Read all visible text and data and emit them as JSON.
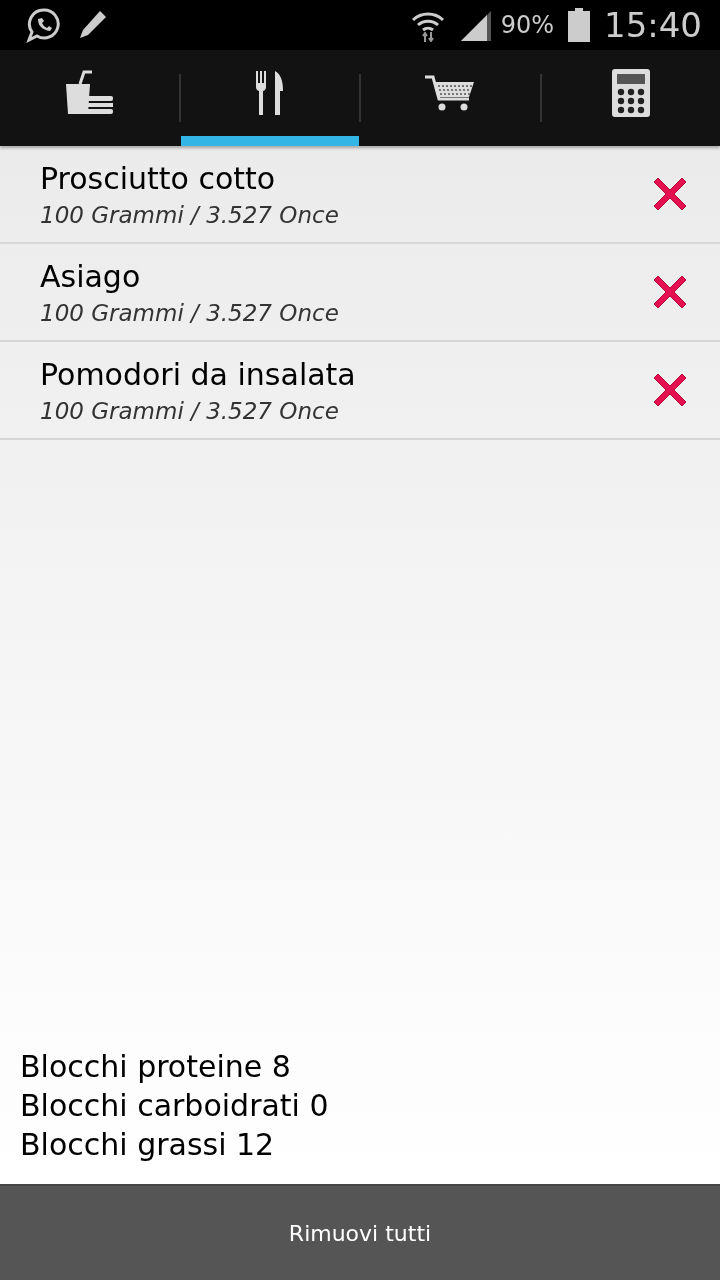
{
  "status_bar": {
    "battery": "90%",
    "time": "15:40"
  },
  "tabs": [
    {
      "kind": "meal",
      "selected": false
    },
    {
      "kind": "cutlery",
      "selected": true
    },
    {
      "kind": "cart",
      "selected": false
    },
    {
      "kind": "calculator",
      "selected": false
    }
  ],
  "items": [
    {
      "name": "Prosciutto cotto",
      "amount": "100 Grammi / 3.527 Once"
    },
    {
      "name": "Asiago",
      "amount": "100 Grammi / 3.527 Once"
    },
    {
      "name": "Pomodori da insalata",
      "amount": "100 Grammi / 3.527 Once"
    }
  ],
  "totals": [
    "Blocchi proteine 8",
    "Blocchi carboidrati 0",
    "Blocchi grassi 12"
  ],
  "button": "Rimuovi tutti"
}
